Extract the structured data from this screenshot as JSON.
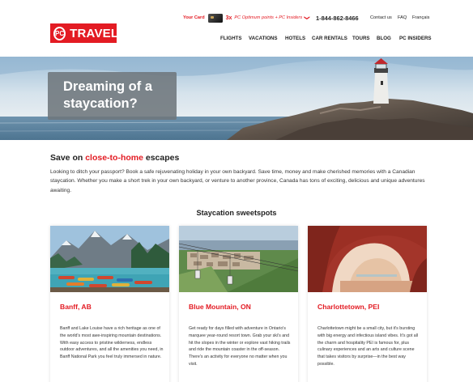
{
  "header": {
    "logo_mark": "PC",
    "logo_text": "TRAVEL",
    "your_card_label": "Your Card",
    "points_multiplier": "3x",
    "points_text": "PC Optimum points + PC Insiders",
    "chevron": "❯",
    "phone": "1-844-862-8466",
    "links": [
      "Contact us",
      "FAQ",
      "Français"
    ],
    "nav": [
      "FLIGHTS",
      "VACATIONS",
      "HOTELS",
      "CAR RENTALS",
      "TOURS",
      "BLOG",
      "PC INSIDERS"
    ]
  },
  "hero": {
    "title": "Dreaming of a staycation?"
  },
  "intro": {
    "heading_prefix": "Save on ",
    "heading_highlight": "close-to-home",
    "heading_suffix": " escapes",
    "body": "Looking to ditch your passport? Book a safe rejuvenating holiday in your own backyard. Save time, money and make cherished memories with a Canadian staycation. Whether you make a short trek in your own backyard, or venture to another province, Canada has tons of exciting, delicious and unique adventures awaiting."
  },
  "sweetspots": {
    "heading": "Staycation sweetspots",
    "cards": [
      {
        "title": "Banff, AB",
        "body": "Banff and Lake Louise have a rich heritage as one of the world's most awe-inspiring mountain destinations. With easy access to pristine wilderness, endless outdoor adventures, and all the amenities you need, in Banff National Park you feel truly immersed in nature."
      },
      {
        "title": "Blue Mountain, ON",
        "body": "Get ready for days filled with adventure in Ontario's marquee year-round resort town. Grab your ski's and hit the slopes in the winter or explore vast hiking trails and ride the mountain coaster in the off-season. There's an activity for everyone no matter when you visit."
      },
      {
        "title": "Charlottetown, PEI",
        "body": "Charlottetown might be a small city, but it's bursting with big energy and infectious island vibes. It's got all the charm and hospitality PEI is famous for, plus culinary experiences and an arts and culture scene that takes visitors by surprise—in the best way possible."
      }
    ]
  },
  "colors": {
    "brand_red": "#e31b23",
    "text_dark": "#222222"
  }
}
